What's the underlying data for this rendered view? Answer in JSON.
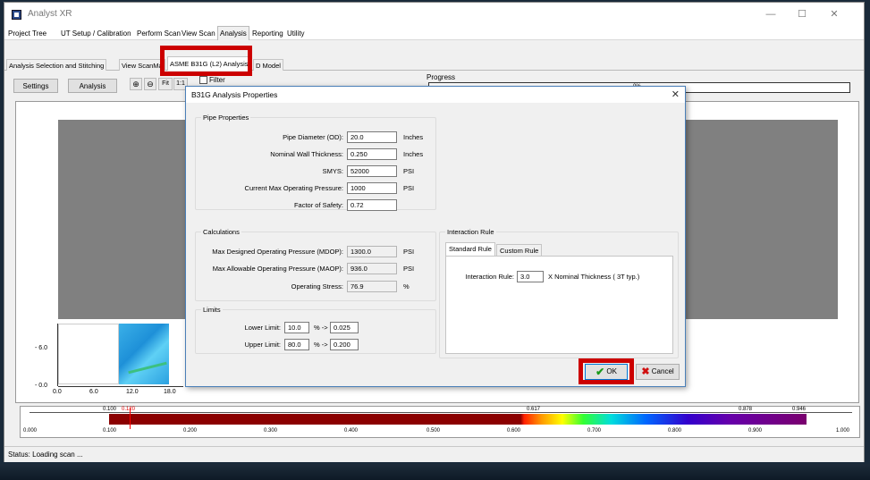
{
  "app": {
    "title": "Analyst XR",
    "minimize": "—",
    "maximize": "☐",
    "close": "✕"
  },
  "menu_tabs": [
    "Project Tree",
    "UT Setup / Calibration",
    "Perform Scan",
    "View Scan",
    "Analysis",
    "Reporting",
    "Utility"
  ],
  "active_menu_tab": "Analysis",
  "sub_tabs": [
    "Analysis Selection and Stitching",
    "View ScanMa",
    "ASME B31G (L2) Analysis",
    "D Model"
  ],
  "active_sub_tab": "ASME B31G (L2) Analysis",
  "toolbar": {
    "settings": "Settings",
    "analysis": "Analysis",
    "zoom_in": "⊕",
    "zoom_out": "⊖",
    "fit": "Fit",
    "one_to_one": "1:1",
    "filter_label": "Filter",
    "progress_label": "Progress",
    "progress_text": "0%"
  },
  "scan": {
    "y_ticks": [
      "6.0",
      "0.0"
    ],
    "x_ticks": [
      "0.0",
      "6.0",
      "12.0",
      "18.0"
    ]
  },
  "colorbar": {
    "top_labels": [
      "0.100",
      "0.120",
      "0.617",
      "0.878",
      "0.946"
    ],
    "bottom_labels": [
      "0.000",
      "0.100",
      "0.200",
      "0.300",
      "0.400",
      "0.500",
      "0.600",
      "0.700",
      "0.800",
      "0.900",
      "1.000"
    ]
  },
  "status": "Status: Loading scan ...",
  "dialog": {
    "title": "B31G Analysis Properties",
    "close": "✕",
    "pipe": {
      "group": "Pipe Properties",
      "diameter_label": "Pipe Diameter (OD):",
      "diameter": "20.0",
      "diameter_unit": "Inches",
      "wall_label": "Nominal Wall Thickness:",
      "wall": "0.250",
      "wall_unit": "Inches",
      "smys_label": "SMYS:",
      "smys": "52000",
      "smys_unit": "PSI",
      "pressure_label": "Current Max Operating Pressure:",
      "pressure": "1000",
      "pressure_unit": "PSI",
      "safety_label": "Factor of Safety:",
      "safety": "0.72"
    },
    "calc": {
      "group": "Calculations",
      "mdop_label": "Max Designed Operating Pressure (MDOP):",
      "mdop": "1300.0",
      "mdop_unit": "PSI",
      "maop_label": "Max Allowable Operating Pressure (MAOP):",
      "maop": "936.0",
      "maop_unit": "PSI",
      "stress_label": "Operating Stress:",
      "stress": "76.9",
      "stress_unit": "%"
    },
    "limits": {
      "group": "Limits",
      "lower_label": "Lower Limit:",
      "lower": "10.0",
      "lower_arrow": "% ->",
      "lower_result": "0.025",
      "upper_label": "Upper Limit:",
      "upper": "80.0",
      "upper_arrow": "% ->",
      "upper_result": "0.200"
    },
    "interaction": {
      "group": "Interaction Rule",
      "tab_standard": "Standard Rule",
      "tab_custom": "Custom Rule",
      "rule_label": "Interaction Rule:",
      "rule_value": "3.0",
      "rule_desc": "X Nominal Thickness ( 3T typ.)"
    },
    "ok": "OK",
    "cancel": "Cancel"
  }
}
